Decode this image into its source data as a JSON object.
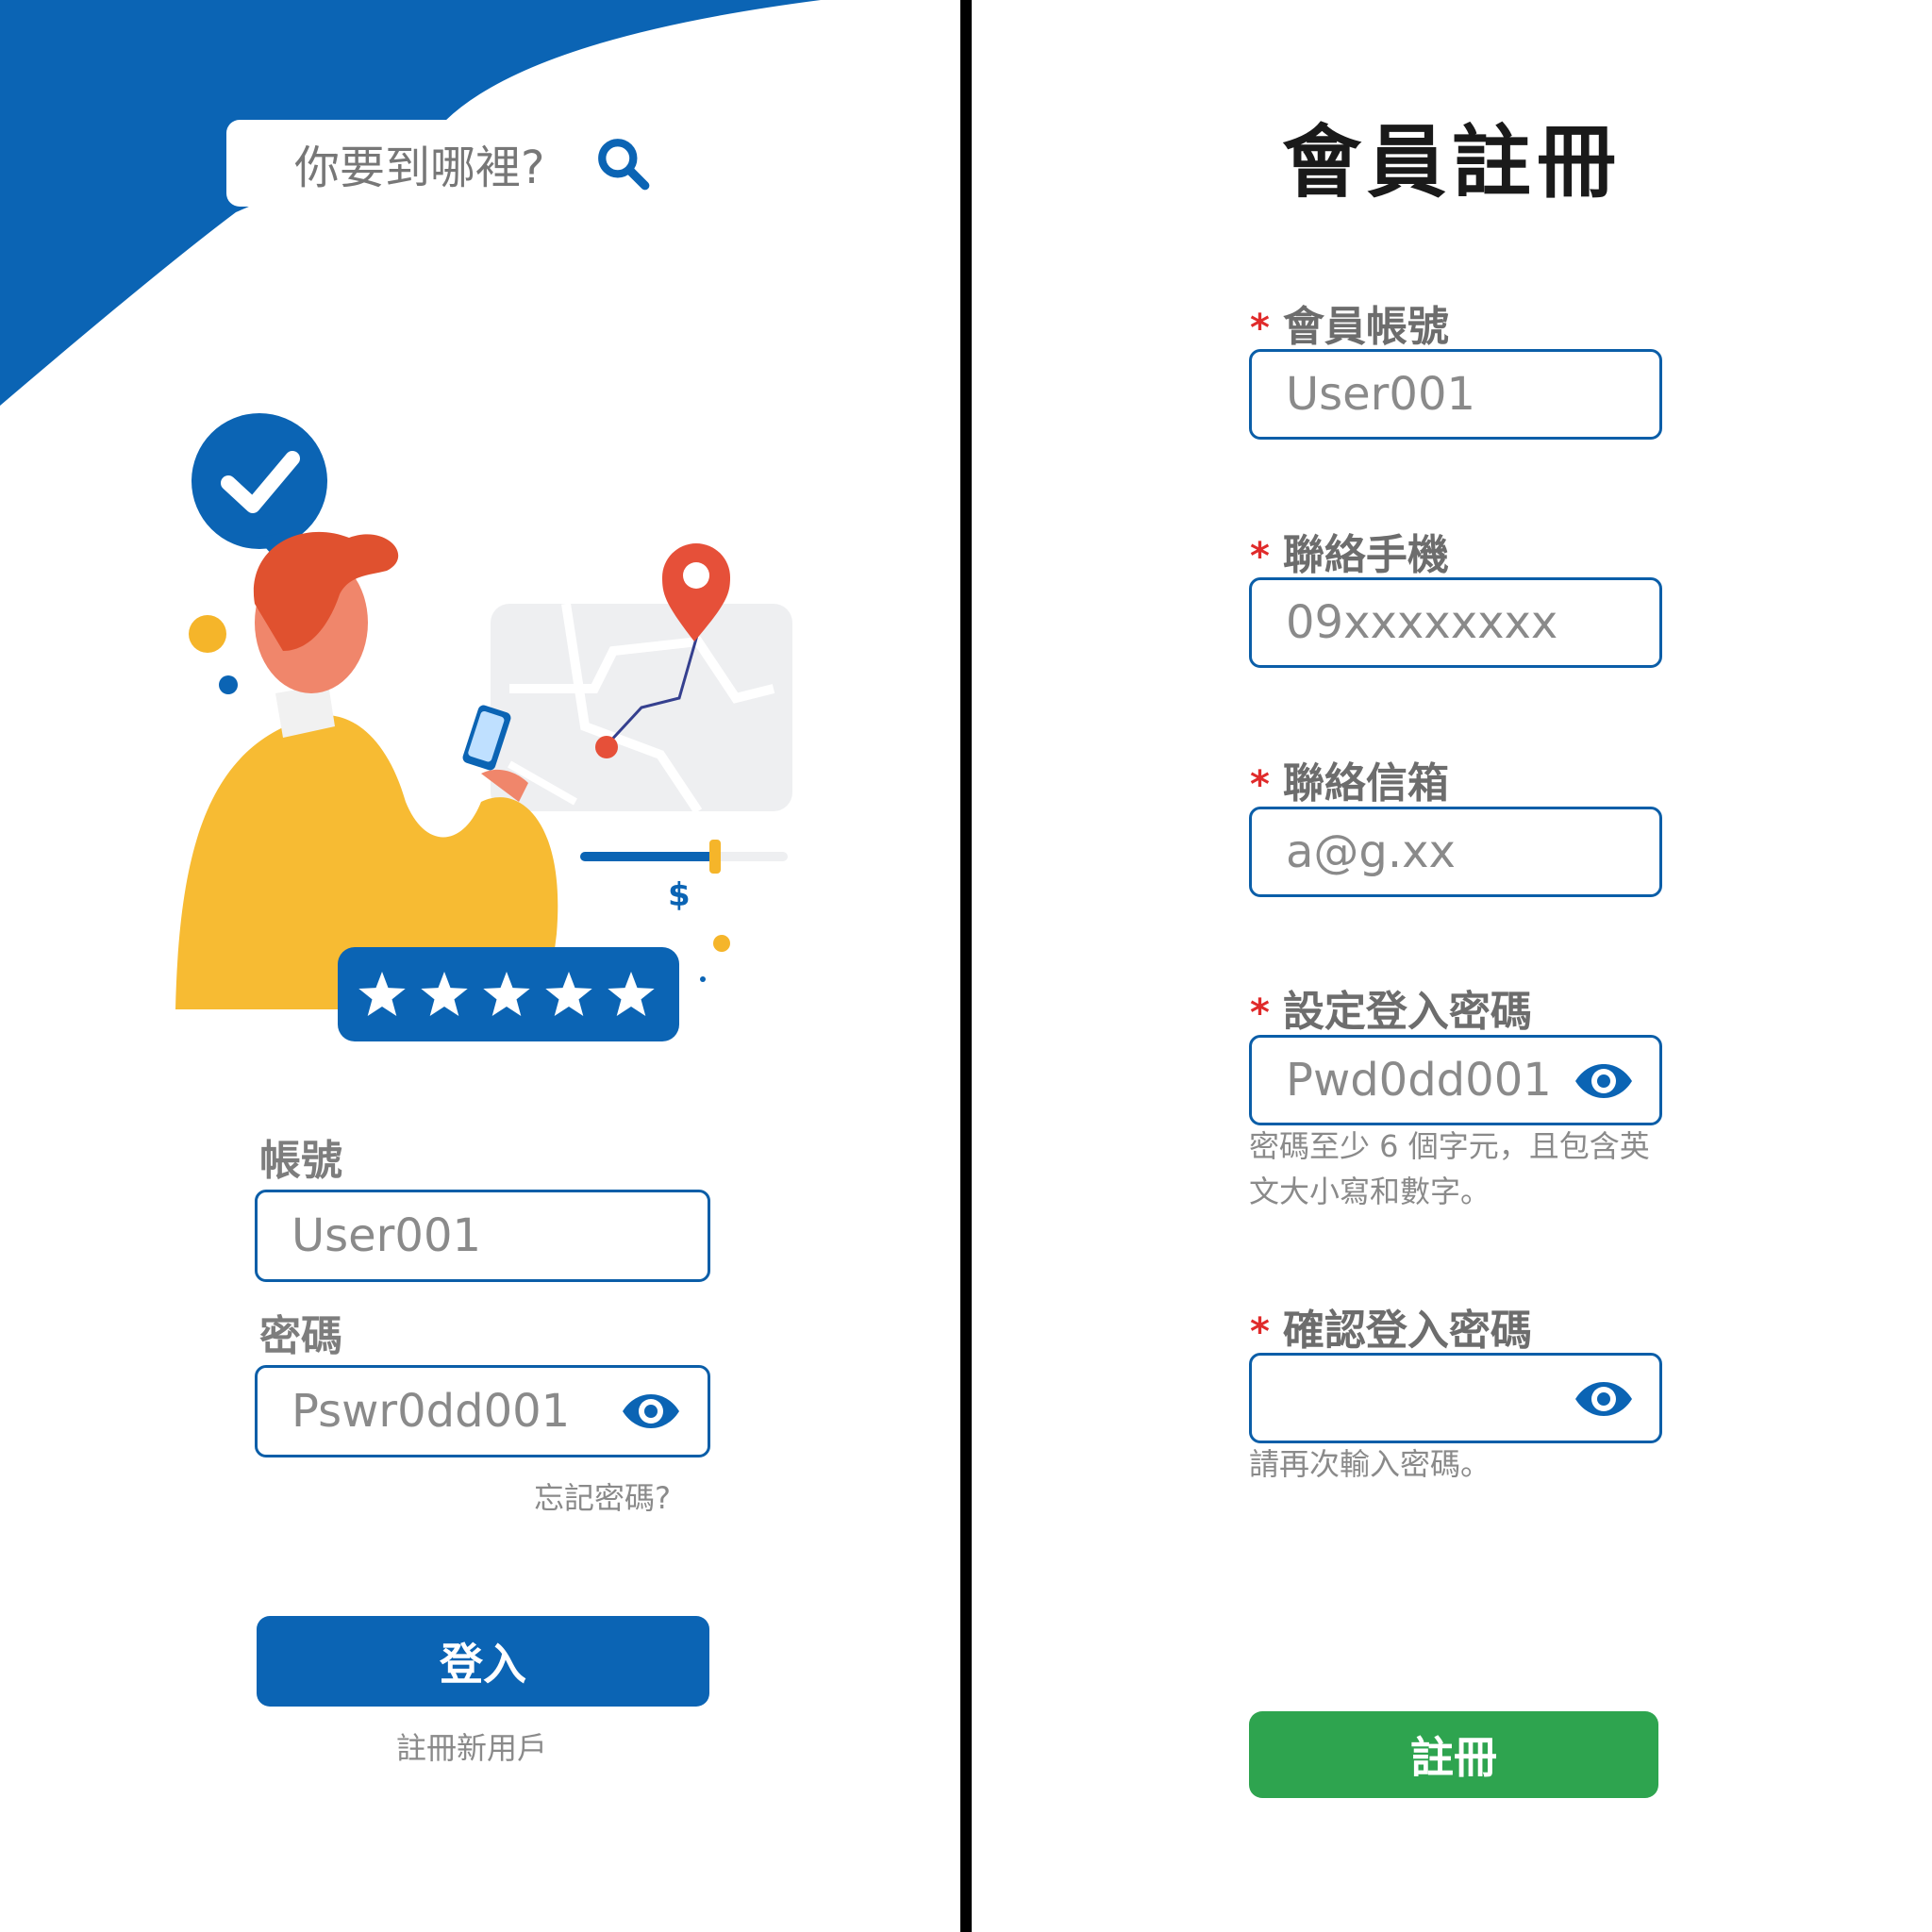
{
  "login": {
    "search": {
      "placeholder": "你要到哪裡?"
    },
    "account_label": "帳號",
    "account_value": "User001",
    "password_label": "密碼",
    "password_value": "Pswr0dd001",
    "forgot_link": "忘記密碼?",
    "login_button": "登入",
    "register_link": "註冊新用戶",
    "rating_stars": 5
  },
  "register": {
    "title": "會員註冊",
    "required_mark": "*",
    "fields": [
      {
        "label": "會員帳號",
        "value": "User001"
      },
      {
        "label": "聯絡手機",
        "value": "09xxxxxxxx"
      },
      {
        "label": "聯絡信箱",
        "value": "a@g.xx"
      },
      {
        "label": "設定登入密碼",
        "value": "Pwd0dd001",
        "hint_line1": "密碼至少 6 個字元，且包含英",
        "hint_line2": "文大小寫和數字。"
      },
      {
        "label": "確認登入密碼",
        "value": "",
        "hint_line1": "請再次輸入密碼。"
      }
    ],
    "register_button": "註冊"
  },
  "colors": {
    "brand_blue": "#0b64b4",
    "accent_green": "#2ea44f",
    "required_red": "#e02b2b"
  }
}
